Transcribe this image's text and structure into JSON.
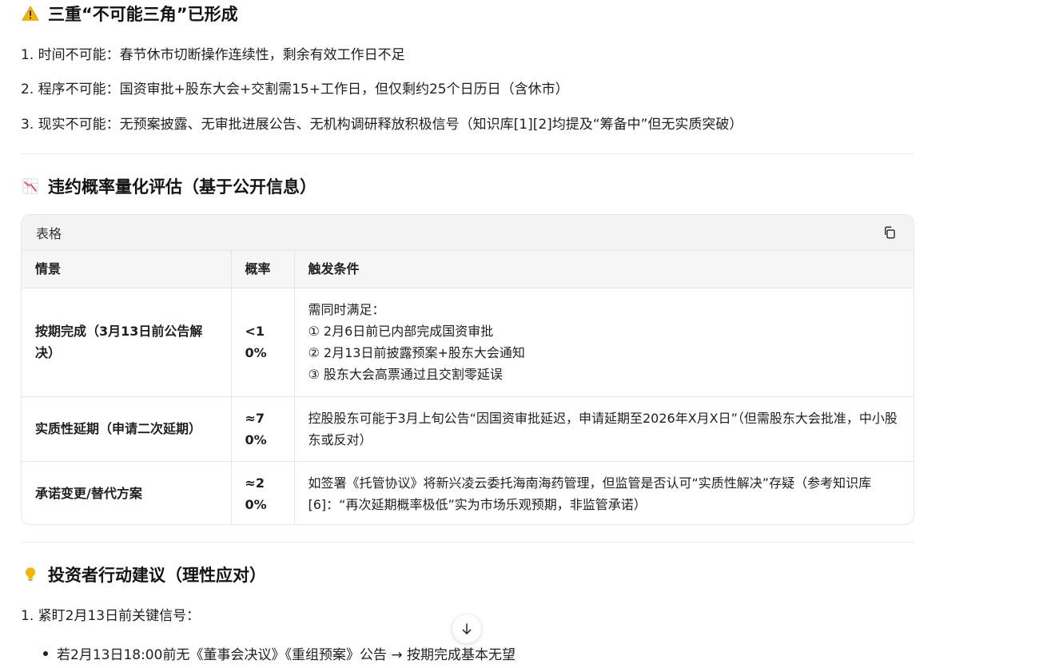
{
  "section1": {
    "icon": "warning-icon",
    "title": "三重“不可能三角”已形成",
    "items": [
      "1. 时间不可能：春节休市切断操作连续性，剩余有效工作日不足",
      "2. 程序不可能：国资审批+股东大会+交割需15+工作日，但仅剩约25个日历日（含休市）",
      "3. 现实不可能：无预案披露、无审批进展公告、无机构调研释放积极信号（知识库[1][2]均提及“筹备中”但无实质突破）"
    ]
  },
  "section2": {
    "icon": "chart-down-icon",
    "title": "违约概率量化评估（基于公开信息）"
  },
  "table": {
    "card_title": "表格",
    "copy_icon": "copy-icon",
    "headers": [
      "情景",
      "概率",
      "触发条件"
    ],
    "rows": [
      {
        "scenario": "按期完成（3月13日前公告解决）",
        "probability": "<10%",
        "conditions": [
          "需同时满足：",
          "① 2月6日前已内部完成国资审批",
          "② 2月13日前披露预案+股东大会通知",
          "③ 股东大会高票通过且交割零延误"
        ]
      },
      {
        "scenario": "实质性延期（申请二次延期）",
        "probability": "≈70%",
        "conditions": [
          "控股股东可能于3月上旬公告“因国资审批延迟，申请延期至2026年X月X日”（但需股东大会批准，中小股东或反对）"
        ]
      },
      {
        "scenario": "承诺变更/替代方案",
        "probability": "≈20%",
        "conditions": [
          "如签署《托管协议》将新兴凌云委托海南海药管理，但监管是否认可“实质性解决”存疑（参考知识库[6]：“再次延期概率极低”实为市场乐观预期，非监管承诺）"
        ]
      }
    ]
  },
  "section3": {
    "icon": "lightbulb-icon",
    "title": "投资者行动建议（理性应对）",
    "items": [
      "1. 紧盯2月13日前关键信号："
    ],
    "bullets": [
      "若2月13日18:00前无《董事会决议》《重组预案》公告 → 按期完成基本无望"
    ]
  },
  "colors": {
    "warning": "#F4B400",
    "chart": "#E0525B",
    "bulb": "#F4B400",
    "text": "#1F1F1F"
  }
}
